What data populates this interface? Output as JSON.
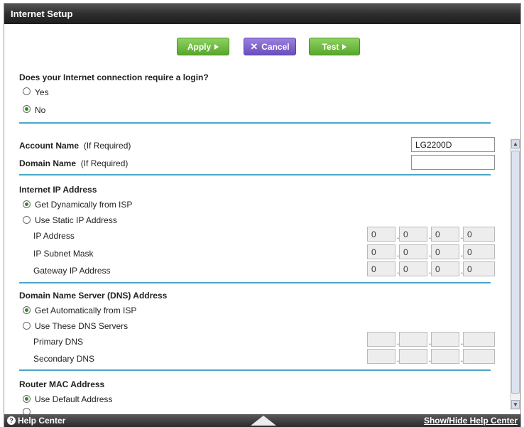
{
  "title": "Internet Setup",
  "toolbar": {
    "apply": "Apply",
    "cancel": "Cancel",
    "test": "Test"
  },
  "login": {
    "question": "Does your Internet connection require a login?",
    "yes": "Yes",
    "no": "No",
    "selected": "No"
  },
  "account": {
    "label": "Account Name",
    "hint": "(If Required)",
    "value": "LG2200D"
  },
  "domain": {
    "label": "Domain Name",
    "hint": "(If Required)",
    "value": ""
  },
  "ip_section": {
    "heading": "Internet IP Address",
    "dynamic": "Get Dynamically from ISP",
    "static": "Use Static IP Address",
    "selected": "dynamic",
    "ip_label": "IP Address",
    "subnet_label": "IP Subnet Mask",
    "gateway_label": "Gateway IP Address",
    "ip": [
      "0",
      "0",
      "0",
      "0"
    ],
    "subnet": [
      "0",
      "0",
      "0",
      "0"
    ],
    "gateway": [
      "0",
      "0",
      "0",
      "0"
    ]
  },
  "dns_section": {
    "heading": "Domain Name Server (DNS) Address",
    "auto": "Get Automatically from ISP",
    "manual": "Use These DNS Servers",
    "selected": "auto",
    "primary_label": "Primary DNS",
    "secondary_label": "Secondary DNS",
    "primary": [
      "",
      "",
      "",
      ""
    ],
    "secondary": [
      "",
      "",
      "",
      ""
    ]
  },
  "mac_section": {
    "heading": "Router MAC Address",
    "default": "Use Default Address"
  },
  "footer": {
    "help": "Help Center",
    "toggle": "Show/Hide Help Center"
  }
}
